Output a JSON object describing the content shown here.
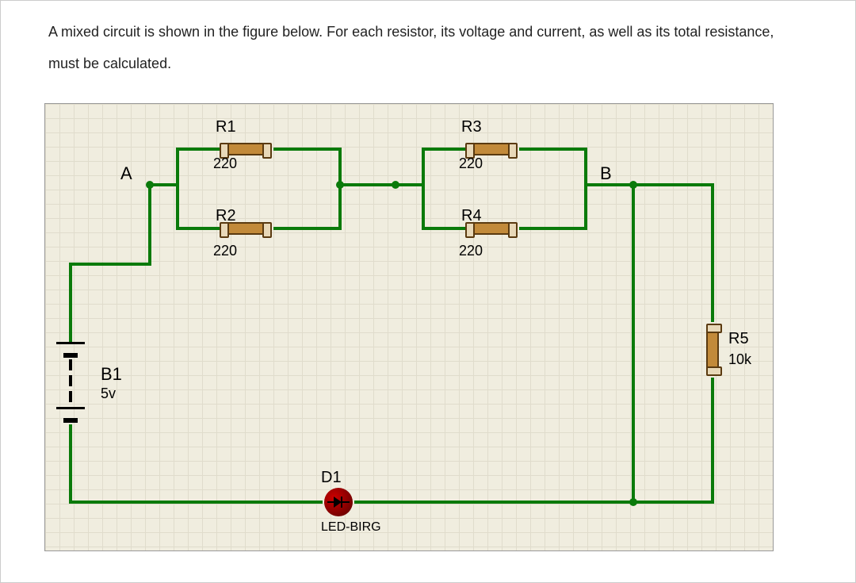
{
  "question": "A mixed circuit is shown in the figure below. For each resistor, its voltage and current, as well as its total resistance, must be calculated.",
  "components": {
    "R1": {
      "name": "R1",
      "value": "220"
    },
    "R2": {
      "name": "R2",
      "value": "220"
    },
    "R3": {
      "name": "R3",
      "value": "220"
    },
    "R4": {
      "name": "R4",
      "value": "220"
    },
    "R5": {
      "name": "R5",
      "value": "10k"
    },
    "B1": {
      "name": "B1",
      "value": "5v"
    },
    "D1": {
      "name": "D1",
      "value": "LED-BIRG"
    }
  },
  "nodes": {
    "A": "A",
    "B": "B"
  }
}
